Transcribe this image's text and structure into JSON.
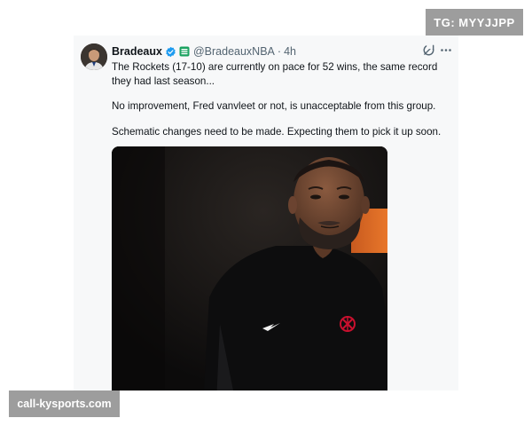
{
  "watermarks": {
    "top_right": "TG: MYYJJPP",
    "bottom_left": "call-kysports.com"
  },
  "tweet": {
    "display_name": "Bradeaux",
    "handle": "@BradeauxNBA",
    "separator": "·",
    "time": "4h",
    "verified_color": "#1d9bf0",
    "badge_color": "#1aa260",
    "paragraphs": [
      "The Rockets (17-10) are currently on pace for 52 wins, the same record they had last season...",
      "No improvement, Fred vanvleet or not, is unacceptable from this group.",
      "Schematic changes need to be made. Expecting them to pick it up soon."
    ],
    "media": {
      "jersey_logo_color": "#c8102e"
    }
  }
}
